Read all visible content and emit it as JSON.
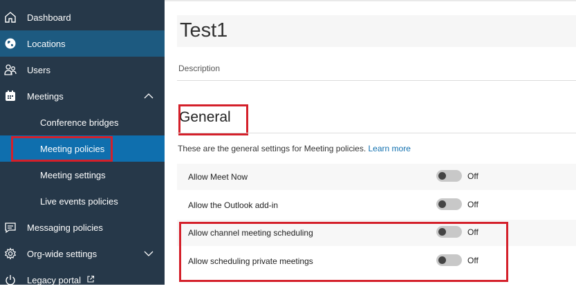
{
  "sidebar": {
    "items": [
      {
        "label": "Dashboard",
        "icon": "home-icon"
      },
      {
        "label": "Locations",
        "icon": "globe-icon"
      },
      {
        "label": "Users",
        "icon": "users-icon"
      },
      {
        "label": "Meetings",
        "icon": "calendar-icon"
      },
      {
        "label": "Conference bridges"
      },
      {
        "label": "Meeting policies"
      },
      {
        "label": "Meeting settings"
      },
      {
        "label": "Live events policies"
      },
      {
        "label": "Messaging policies",
        "icon": "message-icon"
      },
      {
        "label": "Org-wide settings",
        "icon": "gear-icon"
      },
      {
        "label": "Legacy portal",
        "icon": "power-icon"
      }
    ]
  },
  "policy": {
    "title": "Test1",
    "description_placeholder": "Description"
  },
  "general": {
    "heading": "General",
    "intro": "These are the general settings for Meeting policies.",
    "learn_more": "Learn more",
    "settings": [
      {
        "label": "Allow Meet Now",
        "state": "Off"
      },
      {
        "label": "Allow the Outlook add-in",
        "state": "Off"
      },
      {
        "label": "Allow channel meeting scheduling",
        "state": "Off"
      },
      {
        "label": "Allow scheduling private meetings",
        "state": "Off"
      }
    ]
  },
  "colors": {
    "sidebar_bg": "#263849",
    "nav_active": "#1d5a80",
    "nav_selected": "#0f6fae",
    "highlight": "#d4202a",
    "link": "#0f6fae"
  }
}
